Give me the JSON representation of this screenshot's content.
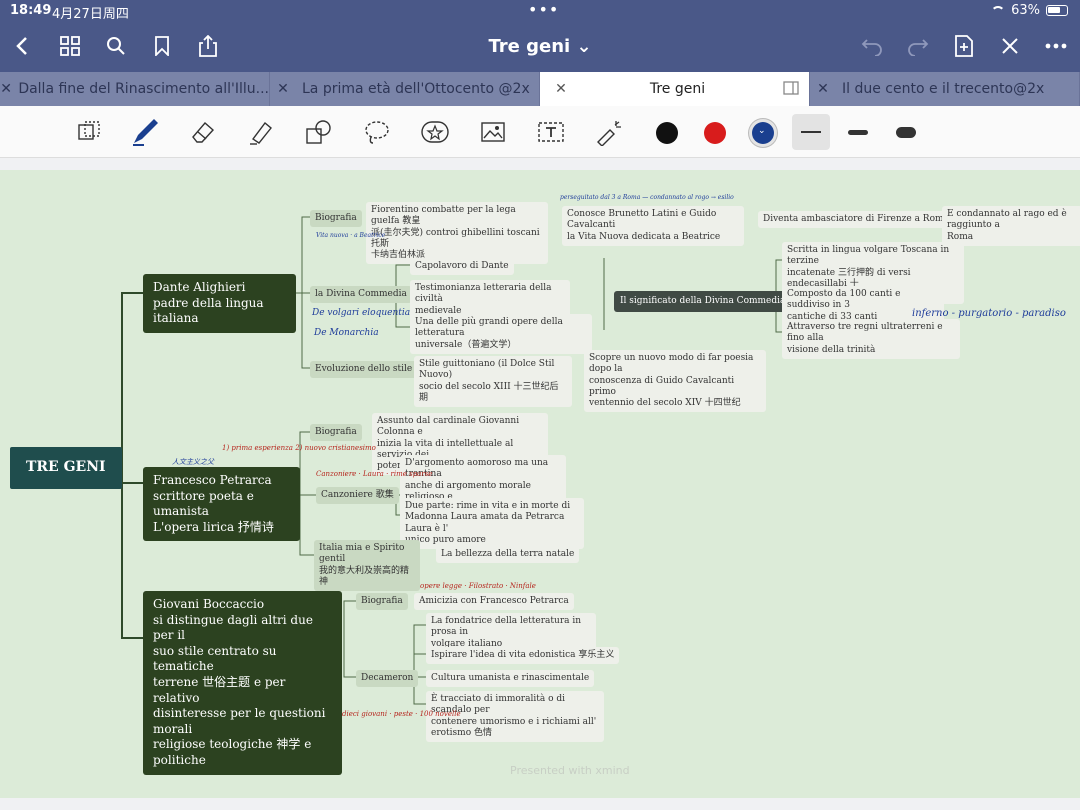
{
  "status": {
    "time": "18:49",
    "date": "4月27日周四",
    "battery": "63%"
  },
  "toolbar": {
    "title": "Tre geni ⌄"
  },
  "tabs": [
    {
      "label": "Dalla fine del Rinascimento all'Illu..."
    },
    {
      "label": "La prima età dell'Ottocento @2x"
    },
    {
      "label": "Tre geni"
    },
    {
      "label": "Il due cento e il trecento@2x"
    }
  ],
  "colors": {
    "black": "#111111",
    "red": "#d81c1c",
    "blue": "#1a3f8f"
  },
  "map": {
    "root": "TRE GENI",
    "dante": {
      "label": "Dante Alighieri\npadre della lingua italiana",
      "biografia": "Biografia",
      "bio_text": "Fiorentino combatte per la lega guelfa 教皇\n派(圭尔夫党) controi ghibellini toscani 托斯\n卡纳吉伯林派",
      "bio_2": "Conosce Brunetto Latini e Guido Cavalcanti\nla Vita Nuova dedicata a Beatrice",
      "bio_3": "Diventa ambasciatore di Firenze a Roma",
      "bio_4": "E condannato al rago ed è raggiunto a\nRoma",
      "commedia": "la Divina Commedia",
      "comm_1": "Capolavoro di Dante",
      "comm_2": "Testimonianza letteraria della civiltà\nmedievale",
      "comm_3": "Una delle più grandi opere della letteratura\nuniversale（普遍文学）",
      "significato": "Il significato della Divina Commedia",
      "sig_1": "Scritta in lingua volgare Toscana in terzine\nincatenate 三行押韵 di versi endecasillabi 十\n一音节",
      "sig_2": "Composto da 100 canti e suddiviso in 3\ncantiche di 33 canti",
      "sig_3": "Attraverso tre regni ultraterreni e fino alla\nvisione della trinità",
      "evoluzione": "Evoluzione dello stile",
      "evo_1": "Stile guittoniano (il Dolce Stil Nuovo)\nsocio del secolo XIII 十三世纪后期",
      "evo_2": "Scopre un nuovo modo di far poesia dopo la\nconoscenza di Guido Cavalcanti primo\nventennio del secolo XIV 十四世纪"
    },
    "petrarca": {
      "label": "Francesco Petrarca\nscrittore poeta e umanista\nL'opera lirica 抒情诗",
      "biografia": "Biografia",
      "bio_text": "Assunto dal cardinale Giovanni Colonna e\ninizia la vita di intellettuale al servizio dei\npotenti",
      "canzoniere": "Canzoniere 歌集",
      "can_1": "D'argomento aomoroso ma una trentina\nanche di argomento morale religioso e\npolitico",
      "can_2": "Due parte: rime in vita e in morte di\nMadonna Laura amata da Petrarca Laura è l'\nunico puro amore",
      "italia": "Italia mia e Spirito gentil\n我的意大利及崇高的精神",
      "italia_1": "La bellezza della terra natale"
    },
    "boccaccio": {
      "label": "Giovani Boccaccio\nsi distingue dagli altri due per il\nsuo stile centrato su tematiche\nterrene 世俗主题 e per relativo\ndisinteresse per le questioni morali\nreligiose teologiche 神学 e politiche",
      "biografia": "Biografia",
      "bio_text": "Amicizia con Francesco Petrarca",
      "decameron": "Decameron",
      "dec_1": "La fondatrice della letteratura in prosa in\nvolgare italiano",
      "dec_2": "Ispirare l'idea di vita edonistica 享乐主义",
      "dec_3": "Cultura umanista e rinascimentale",
      "dec_4": "È tracciato di immoralità o di scandalo per\ncontenere umorismo e i richiami all'\nerotismo 色情"
    },
    "watermark": "Presented with xmind"
  },
  "annotations": {
    "dante_1": "De volgari eloquentia",
    "dante_2": "De Monarchia",
    "sig_note": "inferno - purgatorio - paradiso",
    "bio_note": "perseguitato dal 3 a Roma — condannato al rogo → esilio",
    "bio_small": "Vita nuova · a Beatrice",
    "petr_1": "人文主义之父",
    "petr_2": "Canzoniere · Laura · rime sparse",
    "petr_3": "1) prima esperienza   2) nuovo cristianesimo",
    "bocc_1": "opere legge · Filostrato · Ninfale",
    "bocc_2": "dieci giovani · peste · 100 novelle"
  }
}
